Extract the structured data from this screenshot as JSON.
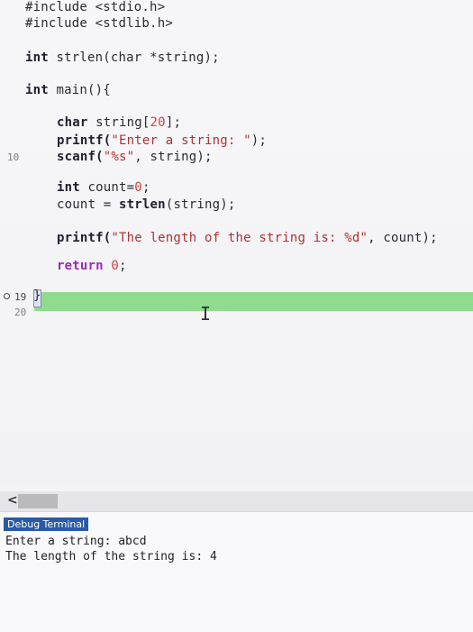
{
  "editor": {
    "lines": {
      "include_stdio": "#include <stdio.h>",
      "include_stdlib": "#include <stdlib.h>",
      "proto_type": "int",
      "proto_rest": " strlen(char *string);",
      "main_type": "int",
      "main_rest": " main(){",
      "decl_type": "char",
      "decl_name": " string[",
      "decl_size": "20",
      "decl_end": "];",
      "printf1_fn": "printf(",
      "printf1_str": "\"Enter a string: \"",
      "printf1_end": ");",
      "scanf_fn": "scanf(",
      "scanf_str": "\"%s\"",
      "scanf_end": ", string);",
      "count_type": "int",
      "count_name": " count=",
      "count_val": "0",
      "count_end": ";",
      "assign_lhs": "count = ",
      "assign_fn": "strlen",
      "assign_rest": "(string);",
      "printf2_fn": "printf(",
      "printf2_str": "\"The length of the string is: %d\"",
      "printf2_end": ", count);",
      "return_kw": "return",
      "return_val": " 0",
      "return_end": ";",
      "close_brace": "}"
    },
    "gutter": {
      "line_10": "10",
      "line_19": "19",
      "line_20": "20"
    },
    "scroll_arrow": "<"
  },
  "terminal": {
    "tab_label": "Debug Terminal",
    "output_1": "Enter a string: abcd",
    "output_2": "The length of the string is: 4"
  }
}
